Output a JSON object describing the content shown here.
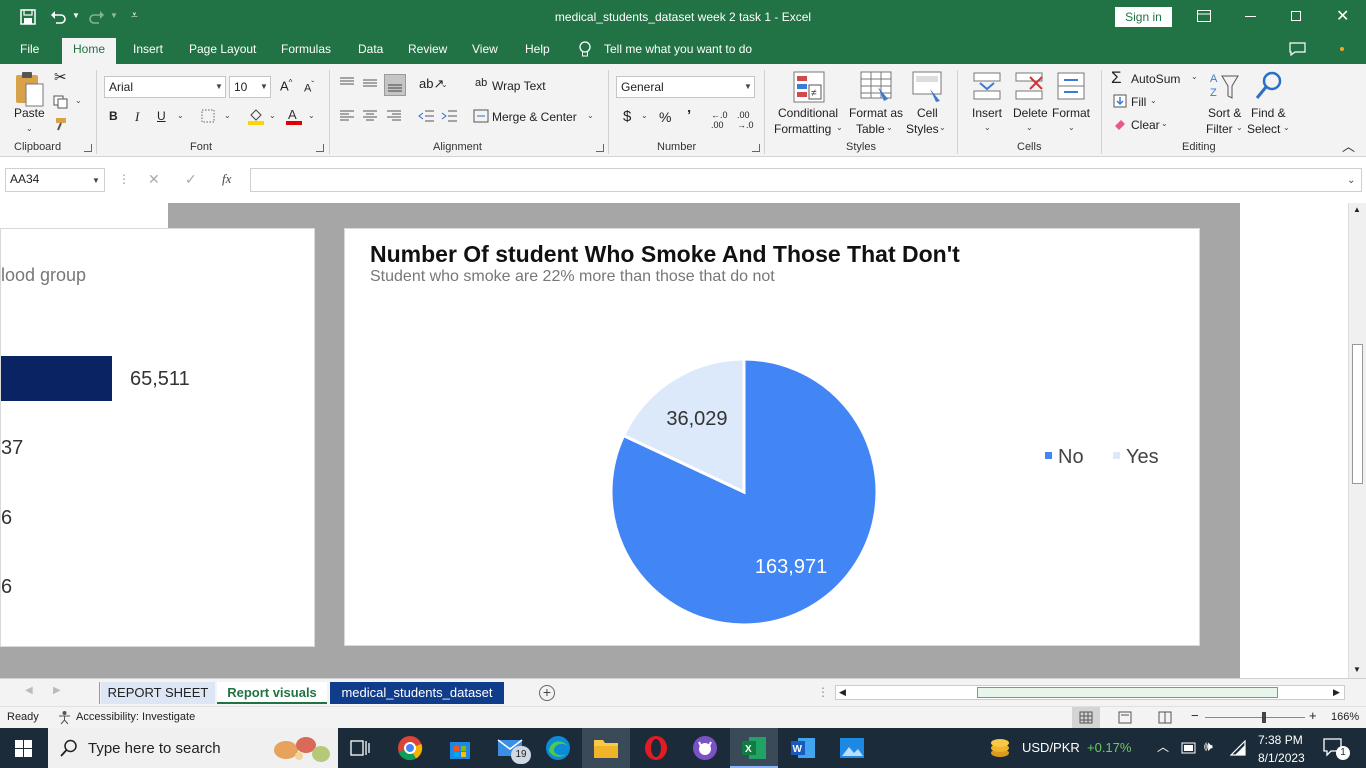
{
  "window": {
    "title": "medical_students_dataset week 2 task 1  -  Excel",
    "sign_in": "Sign in"
  },
  "quick_access": {
    "save_icon": "save-icon",
    "undo_icon": "undo-icon",
    "redo_icon": "redo-icon"
  },
  "menu": {
    "tabs": [
      "File",
      "Home",
      "Insert",
      "Page Layout",
      "Formulas",
      "Data",
      "Review",
      "View",
      "Help"
    ],
    "active": "Home",
    "tell_me": "Tell me what you want to do"
  },
  "ribbon": {
    "clipboard": {
      "paste": "Paste",
      "group": "Clipboard"
    },
    "font": {
      "name": "Arial",
      "size": "10",
      "bold": "B",
      "italic": "I",
      "underline": "U",
      "group": "Font"
    },
    "alignment": {
      "wrap": "Wrap Text",
      "merge": "Merge & Center",
      "group": "Alignment"
    },
    "number": {
      "format": "General",
      "currency": "$",
      "percent": "%",
      "comma": "’",
      "group": "Number"
    },
    "styles": {
      "conditional_1": "Conditional",
      "conditional_2": "Formatting",
      "format_table_1": "Format as",
      "format_table_2": "Table",
      "cell_styles_1": "Cell",
      "cell_styles_2": "Styles",
      "group": "Styles"
    },
    "cells": {
      "insert": "Insert",
      "delete": "Delete",
      "format": "Format",
      "group": "Cells"
    },
    "editing": {
      "autosum": "AutoSum",
      "fill": "Fill",
      "clear": "Clear",
      "sort_1": "Sort &",
      "sort_2": "Filter",
      "find_1": "Find &",
      "find_2": "Select",
      "group": "Editing"
    }
  },
  "formula_bar": {
    "name_box": "AA34",
    "fx": "fx",
    "formula": ""
  },
  "left_chart": {
    "subtitle_fragment": "lood group",
    "bar_value_label": "65,511",
    "labels": [
      "37",
      "6",
      "6"
    ],
    "bar_color": "#0a2463"
  },
  "chart_data": {
    "type": "pie",
    "title": "Number Of student Who Smoke And Those That Don't",
    "subtitle": "Student who smoke are 22% more than those that do not",
    "categories": [
      "No",
      "Yes"
    ],
    "values": [
      163971,
      36029
    ],
    "value_labels": [
      "163,971",
      "36,029"
    ],
    "colors": [
      "#4285f4",
      "#dce9fb"
    ],
    "legend_position": "right"
  },
  "sheet_tabs": [
    "REPORT SHEET",
    "Report visuals",
    "medical_students_dataset"
  ],
  "active_sheet": "Report visuals",
  "status": {
    "ready": "Ready",
    "accessibility": "Accessibility: Investigate",
    "zoom": "166%"
  },
  "taskbar": {
    "search_placeholder": "Type here to search",
    "mail_badge": "19",
    "ticker": "USD/PKR",
    "ticker_change": "+0.17%",
    "time": "7:38 PM",
    "date": "8/1/2023",
    "notifications": "1"
  }
}
